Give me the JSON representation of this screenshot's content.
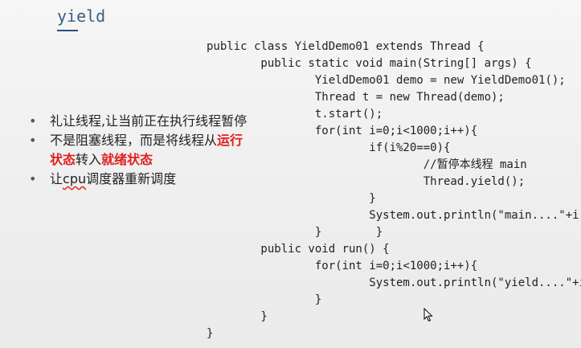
{
  "slide": {
    "title": "yield"
  },
  "bullets": [
    {
      "text": "礼让线程,让当前正在执行线程暂停"
    },
    {
      "before": "不是阻塞线程，而是将线程从",
      "red1a": "运行",
      "red1b": "状态",
      "middle": "转入",
      "red2": "就绪状态"
    },
    {
      "prefix": "让",
      "word": "cpu",
      "suffix": "调度器重新调度"
    }
  ],
  "code": {
    "lines": [
      "public class YieldDemo01 extends Thread {",
      "        public static void main(String[] args) {",
      "                YieldDemo01 demo = new YieldDemo01();",
      "                Thread t = new Thread(demo);",
      "                t.start();",
      "                for(int i=0;i<1000;i++){",
      "                        if(i%20==0){",
      "                                //暂停本线程 main",
      "                                Thread.yield();",
      "                        }",
      "                        System.out.println(\"main....\"+i);",
      "                }        }",
      "        public void run() {",
      "                for(int i=0;i<1000;i++){",
      "                        System.out.println(\"yield....\"+i);",
      "                }",
      "        }",
      "}"
    ]
  }
}
